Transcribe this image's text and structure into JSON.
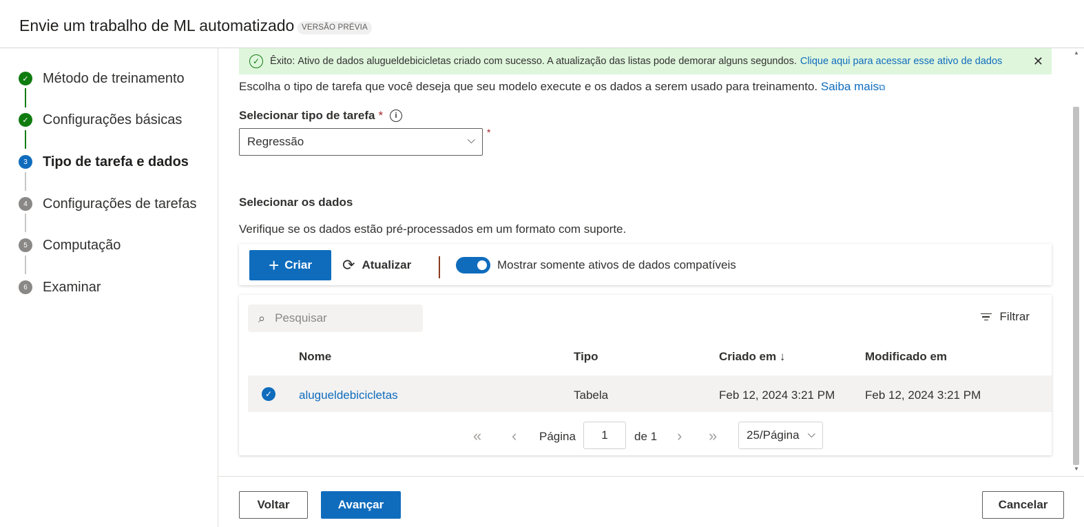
{
  "header": {
    "title": "Envie um trabalho de ML automatizado",
    "badge": "VERSÃO PRÉVIA"
  },
  "stepper": {
    "steps": [
      {
        "number": "1",
        "label": "Método de treinamento",
        "status": "done"
      },
      {
        "number": "2",
        "label": "Configurações básicas",
        "status": "done"
      },
      {
        "number": "3",
        "label": "Tipo de tarefa e dados",
        "status": "current"
      },
      {
        "number": "4",
        "label": "Configurações de tarefas",
        "status": "todo"
      },
      {
        "number": "5",
        "label": "Computação",
        "status": "todo"
      },
      {
        "number": "6",
        "label": "Examinar",
        "status": "todo"
      }
    ]
  },
  "success": {
    "strong": "Êxito:",
    "text": "Ativo de dados alugueldebicicletas criado com sucesso. A atualização das listas pode demorar alguns segundos.",
    "link": "Clique aqui para acessar esse ativo de dados"
  },
  "intro": {
    "text": "Escolha o tipo de tarefa que você deseja que seu modelo execute e os dados a serem usado para treinamento.",
    "link": "Saiba mais"
  },
  "task_type": {
    "label": "Selecionar tipo de tarefa",
    "required_mark": "*",
    "selected": "Regressão"
  },
  "data": {
    "title": "Selecionar os dados",
    "description": "Verifique se os dados estão pré-processados em um formato com suporte.",
    "toolbar": {
      "create": "Criar",
      "refresh": "Atualizar",
      "toggle_label": "Mostrar somente ativos de dados compatíveis",
      "toggle_on": true
    },
    "search_placeholder": "Pesquisar",
    "filter": "Filtrar",
    "columns": [
      "Nome",
      "Tipo",
      "Criado em ↓",
      "Modificado em"
    ],
    "rows": [
      {
        "name": "alugueldebicicletas",
        "type": "Tabela",
        "created": "Feb 12, 2024 3:21 PM",
        "modified": "Feb 12, 2024 3:21 PM",
        "selected": true
      }
    ],
    "pager": {
      "page_label": "Página",
      "page": "1",
      "of": "de 1",
      "page_size": "25/Página"
    }
  },
  "footer": {
    "back": "Voltar",
    "next": "Avançar",
    "cancel": "Cancelar"
  },
  "colors": {
    "accent": "#0f6cbd",
    "success": "#107c10",
    "success_bg": "#dff6dd",
    "required": "#a4262c"
  }
}
